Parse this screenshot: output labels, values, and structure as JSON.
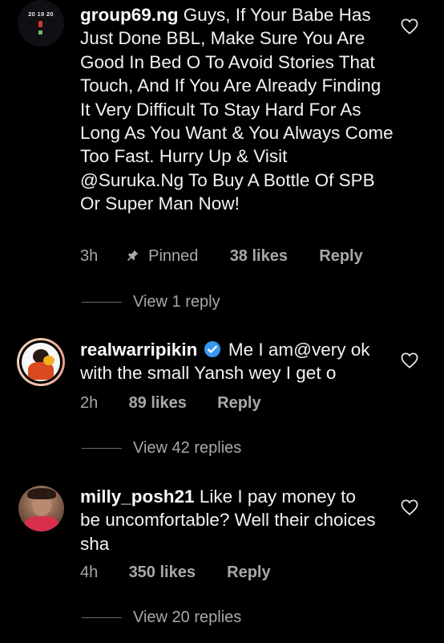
{
  "comments": [
    {
      "avatar_text": "20 19 20",
      "username": "group69.ng",
      "text": "Guys, If Your Babe Has Just Done BBL, Make Sure You Are Good In Bed O To Avoid Stories That Touch, And If You Are Already Finding It Very Difficult To Stay Hard For As Long As You Want & You Always Come Too Fast. Hurry Up & Visit @Suruka.Ng To Buy A Bottle Of SPB Or Super Man Now!",
      "time": "3h",
      "pinned_label": "Pinned",
      "likes": "38 likes",
      "reply_label": "Reply",
      "view_replies": "View 1 reply"
    },
    {
      "username": "realwarripikin",
      "verified": true,
      "text": "Me I am@very ok with the small Yansh wey I get o",
      "time": "2h",
      "likes": "89 likes",
      "reply_label": "Reply",
      "view_replies": "View 42 replies"
    },
    {
      "username": "milly_posh21",
      "text": "Like I pay money to be uncomfortable? Well their choices sha",
      "time": "4h",
      "likes": "350 likes",
      "reply_label": "Reply",
      "view_replies": "View 20 replies"
    }
  ],
  "icons": {
    "heart": "heart-outline-icon",
    "pin": "pin-icon",
    "verified": "verified-badge-icon"
  },
  "colors": {
    "background": "#000000",
    "text": "#f2f2f2",
    "muted": "#a8a8a8",
    "verified": "#3897f0",
    "story_ring": "#e8b7a0"
  }
}
